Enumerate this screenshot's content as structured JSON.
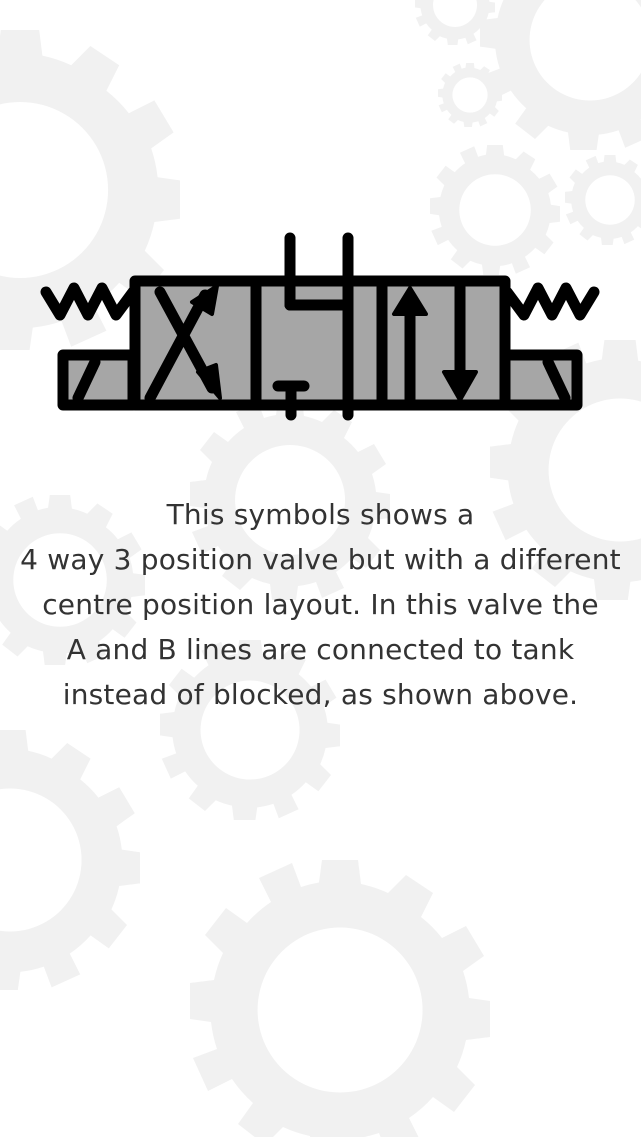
{
  "screen": {
    "background_color": "#ffffff",
    "gear_color": "#f1f1f1"
  },
  "symbol": {
    "icon": "valve-4-way-3-position-symbol",
    "fill_color": "#a6a6a6",
    "stroke_color": "#000000"
  },
  "description": {
    "lines": [
      "This symbols shows a",
      "4 way 3 position valve but with a different",
      "centre position layout. In this valve the",
      "A and B lines are connected to tank",
      "instead of blocked, as shown above."
    ],
    "text_color": "#333333"
  }
}
